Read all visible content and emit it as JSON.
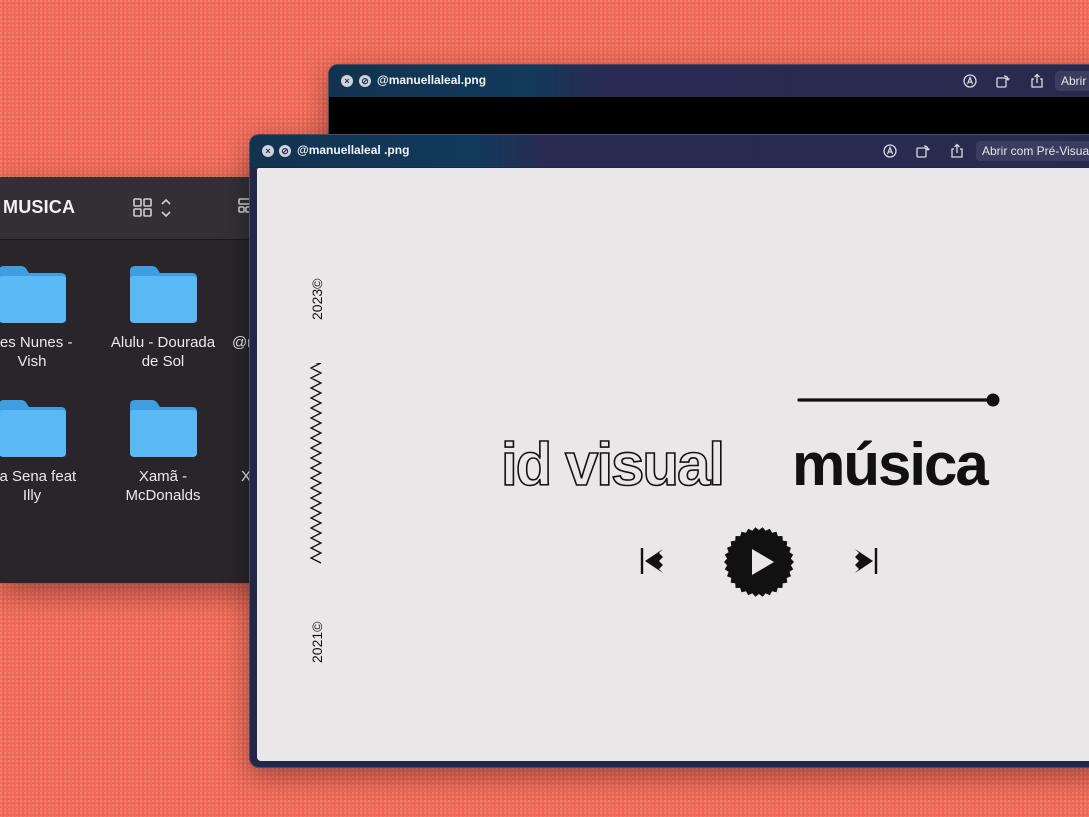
{
  "finder": {
    "title": "MUSICA",
    "folders": [
      {
        "line1": "nes Nunes -",
        "line2": "Vish"
      },
      {
        "line1": "Alulu - Dourada",
        "line2": "de Sol"
      },
      {
        "line1": "@r",
        "line2": ""
      },
      {
        "line1": "ina Sena feat",
        "line2": "Illy"
      },
      {
        "line1": "Xamã -",
        "line2": "McDonalds"
      },
      {
        "line1": "X",
        "line2": ""
      }
    ],
    "folder_color": "#5ab8f5"
  },
  "preview_back": {
    "title": "@manuellaleal.png",
    "open_label": "Abrir"
  },
  "preview_front": {
    "title": "@manuellaleal .png",
    "open_label": "Abrir com Pré-Visual"
  },
  "art": {
    "year_top": "2023©",
    "year_bottom": "2021©",
    "word_outline": "id visual",
    "word_solid": "música",
    "progress": 1.0
  },
  "colors": {
    "background": "#f06a58",
    "canvas": "#e9e7e8",
    "ink": "#111111"
  }
}
